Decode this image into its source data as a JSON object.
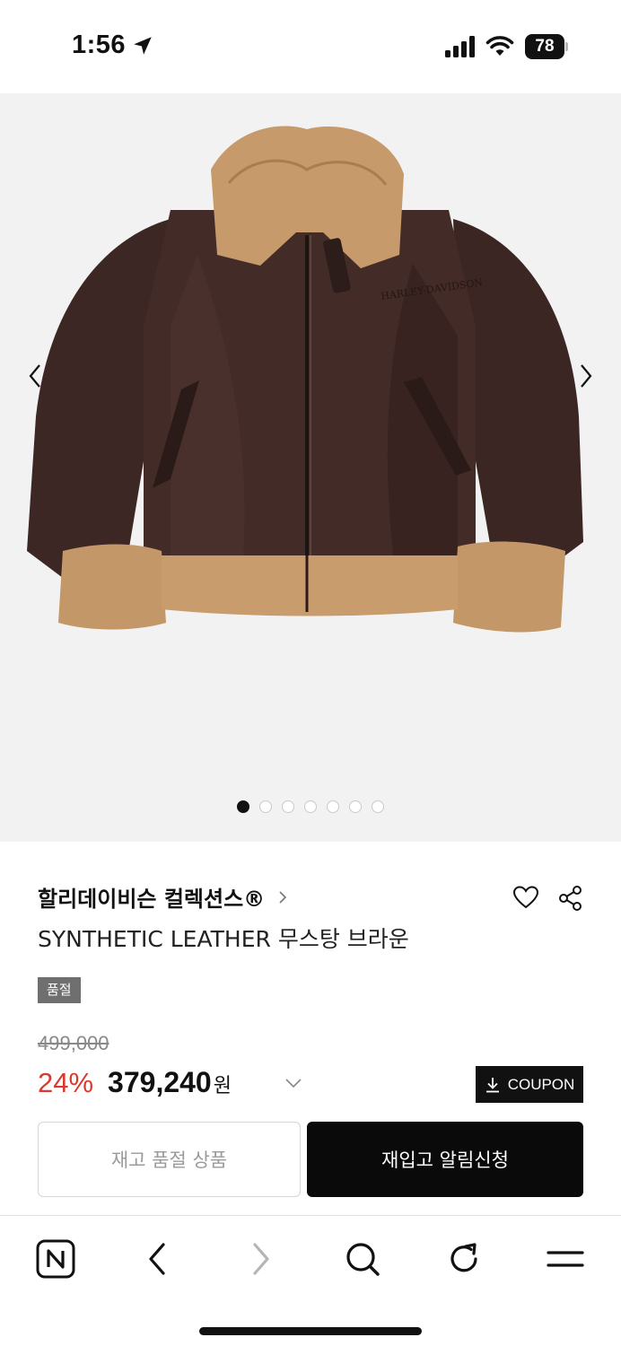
{
  "status_bar": {
    "time": "1:56",
    "battery": "78",
    "icons": [
      "location-arrow-icon",
      "signal-icon",
      "wifi-icon",
      "battery-icon"
    ]
  },
  "gallery": {
    "image": "brown synthetic leather mustang jacket with shearling collar",
    "slide_count": 7,
    "active_slide": 1
  },
  "product": {
    "brand": "할리데이비슨 컬렉션스®",
    "name": "SYNTHETIC LEATHER 무스탕 브라운",
    "badge": "품절",
    "original_price": "499,000",
    "discount": "24%",
    "price": "379,240",
    "currency": "원",
    "coupon_label": "COUPON"
  },
  "actions": {
    "soldout_label": "재고 품절 상품",
    "restock_label": "재입고 알림신청"
  },
  "colors": {
    "discount": "#d83a2f",
    "primary_button": "#0a0a0a",
    "badge": "#6f6f6f",
    "gallery_bg": "#f2f2f2"
  }
}
